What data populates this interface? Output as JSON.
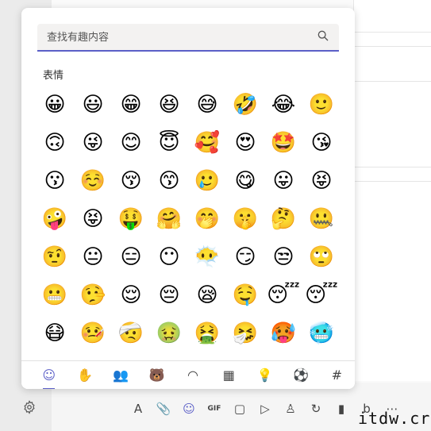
{
  "search": {
    "placeholder": "查找有趣内容"
  },
  "section_title": "表情",
  "emojis": [
    [
      "😀",
      "😃",
      "😁",
      "😆",
      "😅",
      "🤣",
      "😂",
      "🙂"
    ],
    [
      "🙃",
      "😜",
      "😊",
      "😇",
      "🥰",
      "😍",
      "🤩",
      "😘"
    ],
    [
      "😗",
      "☺️",
      "😚",
      "😙",
      "🥲",
      "😋",
      "😛",
      "😝"
    ],
    [
      "🤪",
      "😝",
      "🤑",
      "🤗",
      "🤭",
      "🤫",
      "🤔",
      "🤐"
    ],
    [
      "🤨",
      "😐",
      "😑",
      "😶",
      "😶‍🌫️",
      "😏",
      "😒",
      "🙄"
    ],
    [
      "😬",
      "🤥",
      "😌",
      "😔",
      "😪",
      "🤤",
      "😴",
      "😴"
    ],
    [
      "😷",
      "🤒",
      "🤕",
      "🤢",
      "🤮",
      "🤧",
      "🥵",
      "🥶"
    ]
  ],
  "tabs": [
    {
      "name": "tab-smileys",
      "icon": "☺"
    },
    {
      "name": "tab-people",
      "icon": "✋"
    },
    {
      "name": "tab-group",
      "icon": "👥"
    },
    {
      "name": "tab-animals",
      "icon": "🐻"
    },
    {
      "name": "tab-food",
      "icon": "◠"
    },
    {
      "name": "tab-objects",
      "icon": "▦"
    },
    {
      "name": "tab-ideas",
      "icon": "💡"
    },
    {
      "name": "tab-activities",
      "icon": "⚽"
    },
    {
      "name": "tab-symbols",
      "icon": "#"
    }
  ],
  "toolbar": [
    {
      "name": "format-icon",
      "icon": "A"
    },
    {
      "name": "attach-icon",
      "icon": "📎"
    },
    {
      "name": "emoji-icon",
      "icon": "☺"
    },
    {
      "name": "gif-icon",
      "icon": "GIF"
    },
    {
      "name": "sticker-icon",
      "icon": "▢"
    },
    {
      "name": "send-schedule-icon",
      "icon": "▷"
    },
    {
      "name": "praise-icon",
      "icon": "♙"
    },
    {
      "name": "loop-icon",
      "icon": "↻"
    },
    {
      "name": "apps-icon",
      "icon": "▮"
    },
    {
      "name": "bing-icon",
      "icon": "b"
    },
    {
      "name": "more-icon",
      "icon": "⋯"
    }
  ],
  "watermark": "itdw.cr",
  "colors": {
    "accent": "#5b5fc7"
  }
}
